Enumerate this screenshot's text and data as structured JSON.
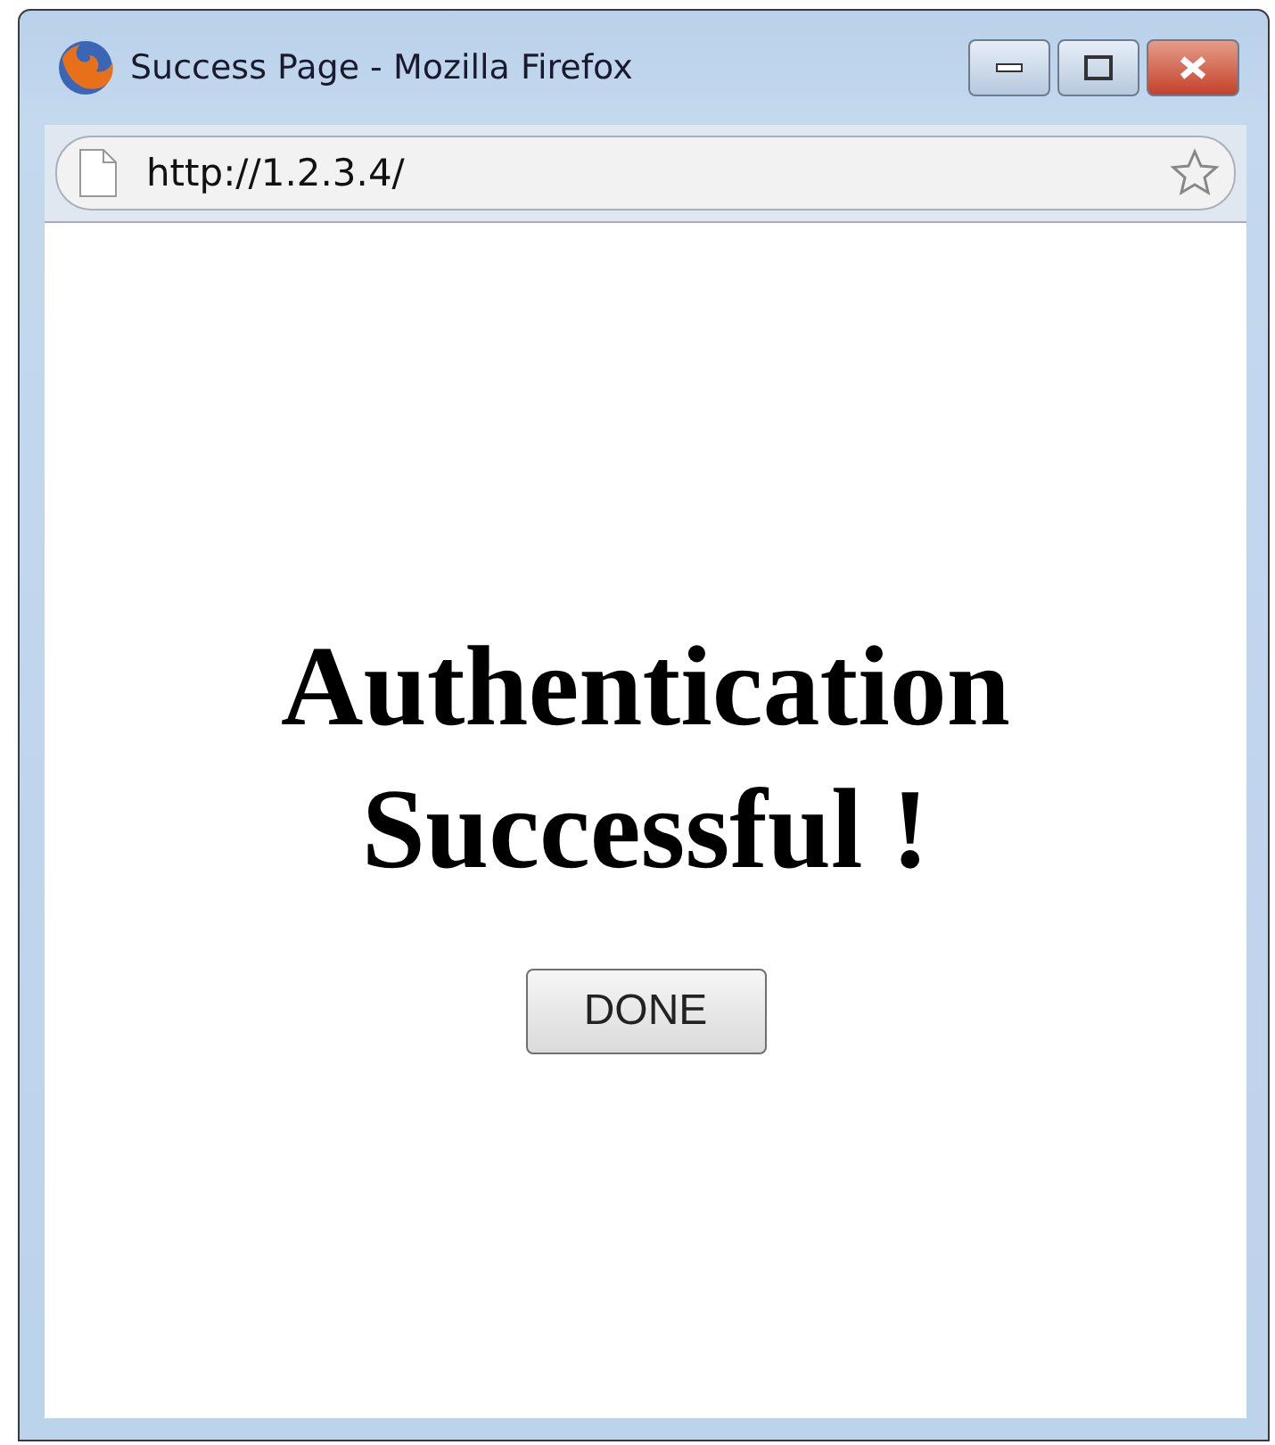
{
  "window": {
    "title": "Success Page - Mozilla Firefox"
  },
  "address_bar": {
    "value": "http://1.2.3.4/"
  },
  "page": {
    "heading": "Authentication Successful !",
    "button": "DONE"
  }
}
